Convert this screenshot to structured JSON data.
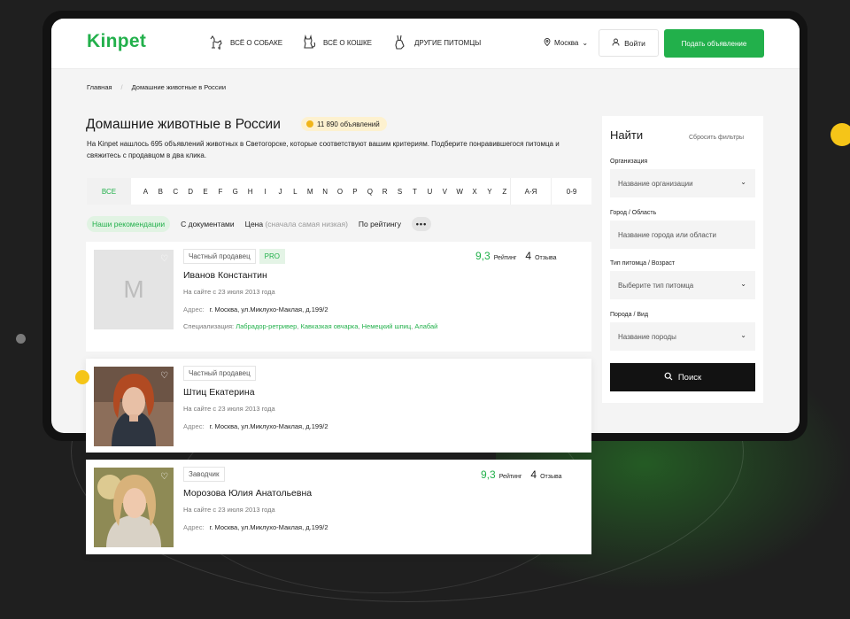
{
  "brand": {
    "logo": "Kinpet",
    "accent": "#22b04b"
  },
  "header": {
    "nav": [
      {
        "label": "ВСЁ О СОБАКЕ",
        "icon": "dog-icon"
      },
      {
        "label": "ВСЁ О КОШКЕ",
        "icon": "cat-icon"
      },
      {
        "label": "ДРУГИЕ ПИТОМЦЫ",
        "icon": "rabbit-icon"
      }
    ],
    "city": "Москва",
    "login": "Войти",
    "post_ad": "Подать объявление"
  },
  "breadcrumb": [
    "Главная",
    "Домашние животные в России"
  ],
  "page": {
    "title": "Домашние животные в России",
    "count_badge": "11 890 объявлений",
    "description": "На Kinpet нашлось 695 объявлений животных в Светогорске, которые соответствуют вашим критериям. Подберите понравившегося питомца и свяжитесь с продавцом в два клика."
  },
  "alphabet": {
    "all": "ВСЕ",
    "letters": [
      "A",
      "B",
      "C",
      "D",
      "E",
      "F",
      "G",
      "H",
      "I",
      "J",
      "L",
      "M",
      "N",
      "O",
      "P",
      "Q",
      "R",
      "S",
      "T",
      "U",
      "V",
      "W",
      "X",
      "Y",
      "Z"
    ],
    "ranges": [
      "А-Я",
      "0-9"
    ]
  },
  "sort": {
    "items": [
      "Наши рекомендации",
      "С документами",
      "Цена"
    ],
    "price_hint": "(сначала самая низкая)",
    "rating": "По рейтингу",
    "more": "•••"
  },
  "sidebar": {
    "title": "Найти",
    "reset": "Сбросить фильтры",
    "fields": [
      {
        "label": "Организация",
        "placeholder": "Название организации",
        "dropdown": true
      },
      {
        "label": "Город / Область",
        "placeholder": "Название города или области",
        "dropdown": false
      },
      {
        "label": "Тип питомца / Возраст",
        "placeholder": "Выберите тип питомца",
        "dropdown": true
      },
      {
        "label": "Порода / Вид",
        "placeholder": "Название породы",
        "dropdown": true
      }
    ],
    "search": "Поиск"
  },
  "sellers": [
    {
      "initial": "M",
      "tags": [
        "Частный продавец",
        "PRO"
      ],
      "name": "Иванов Константин",
      "since": "На сайте с 23 июля 2013 года",
      "address_label": "Адрес:",
      "address": "г. Москва, ул.Миклухо-Маклая, д.199/2",
      "spec_label": "Специализация:",
      "specializations": [
        "Лабрадор-ретривер",
        "Кавказкая овчарка",
        "Немецкий шпиц",
        "Алабай"
      ],
      "score": "9,3",
      "score_label": "Рейтинг",
      "reviews": "4",
      "reviews_label": "Отзыва"
    },
    {
      "tags": [
        "Частный продавец"
      ],
      "name": "Штиц Екатерина",
      "since": "На сайте с 23 июля 2013 года",
      "address_label": "Адрес:",
      "address": "г. Москва, ул.Миклухо-Маклая, д.199/2"
    },
    {
      "tags": [
        "Заводчик"
      ],
      "name": "Морозова Юлия Анатольевна",
      "since": "На сайте с 23 июля 2013 года",
      "address_label": "Адрес:",
      "address": "г. Москва, ул.Миклухо-Маклая, д.199/2",
      "score": "9,3",
      "score_label": "Рейтинг",
      "reviews": "4",
      "reviews_label": "Отзыва"
    }
  ]
}
